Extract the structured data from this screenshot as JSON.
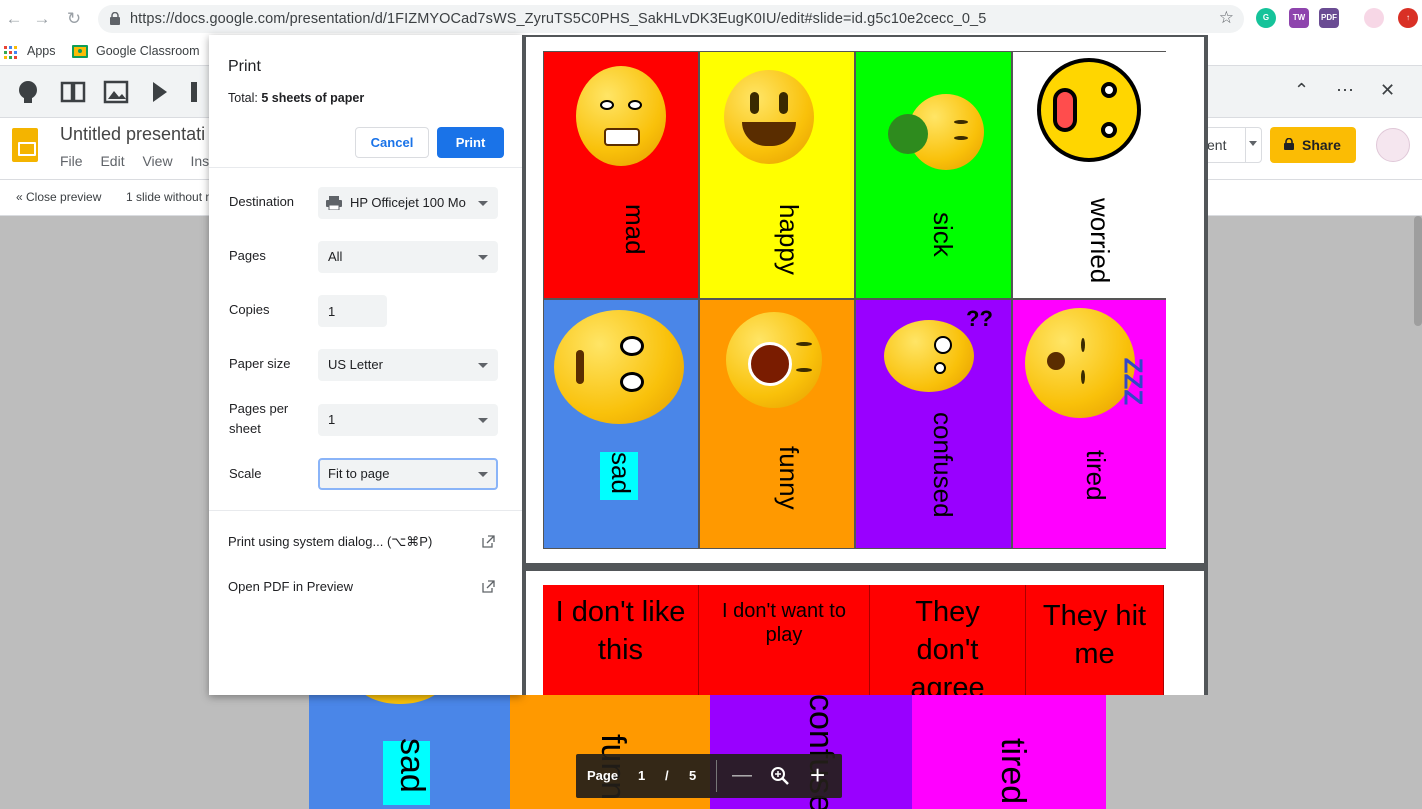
{
  "browser": {
    "url": "https://docs.google.com/presentation/d/1FIZMYOCad7sWS_ZyruTS5C0PHS_SakHLvDK3EugK0IU/edit#slide=id.g5c10e2cecc_0_5",
    "bookmarks": [
      "Apps",
      "Google Classroom"
    ]
  },
  "slides": {
    "doc_title": "Untitled presentati",
    "menu": [
      "File",
      "Edit",
      "View",
      "Inse"
    ],
    "present_label": "ent",
    "share_label": "Share",
    "close_preview": "« Close preview",
    "preview_info": "1 slide without n"
  },
  "print": {
    "title": "Print",
    "total_prefix": "Total:",
    "total_value": "5 sheets of paper",
    "cancel": "Cancel",
    "print": "Print",
    "destination_label": "Destination",
    "destination_value": "HP Officejet 100 Mo",
    "pages_label": "Pages",
    "pages_value": "All",
    "copies_label": "Copies",
    "copies_value": "1",
    "paper_size_label": "Paper size",
    "paper_size_value": "US Letter",
    "pages_per_sheet_label_1": "Pages per",
    "pages_per_sheet_label_2": "sheet",
    "pages_per_sheet_value": "1",
    "scale_label": "Scale",
    "scale_value": "Fit to page",
    "system_dialog": "Print using system dialog... (⌥⌘P)",
    "open_pdf": "Open PDF in Preview"
  },
  "preview": {
    "page1_cards": [
      "mad",
      "happy",
      "sick",
      "worried",
      "sad",
      "funny",
      "confused",
      "tired"
    ],
    "page2_cards": [
      {
        "line1": "I don't like",
        "line2": "this"
      },
      {
        "line1": "I don't want to",
        "line2": "play"
      },
      {
        "line1": "They",
        "line2": "don't",
        "line3": "agree"
      },
      {
        "line1": "They hit",
        "line2": "me"
      }
    ],
    "colors": {
      "red": "#ff0000",
      "yellow": "#ffff00",
      "green": "#00ff00",
      "white": "#ffffff",
      "blue": "#4a86e8",
      "orange": "#ff9900",
      "purple": "#9900ff",
      "magenta": "#ff00ff",
      "cyan": "#00ffff"
    }
  },
  "background_cards": [
    "sad",
    "funn",
    "confuse",
    "tired"
  ],
  "page_control": {
    "label": "Page",
    "current": "1",
    "slash": "/",
    "total": "5"
  }
}
